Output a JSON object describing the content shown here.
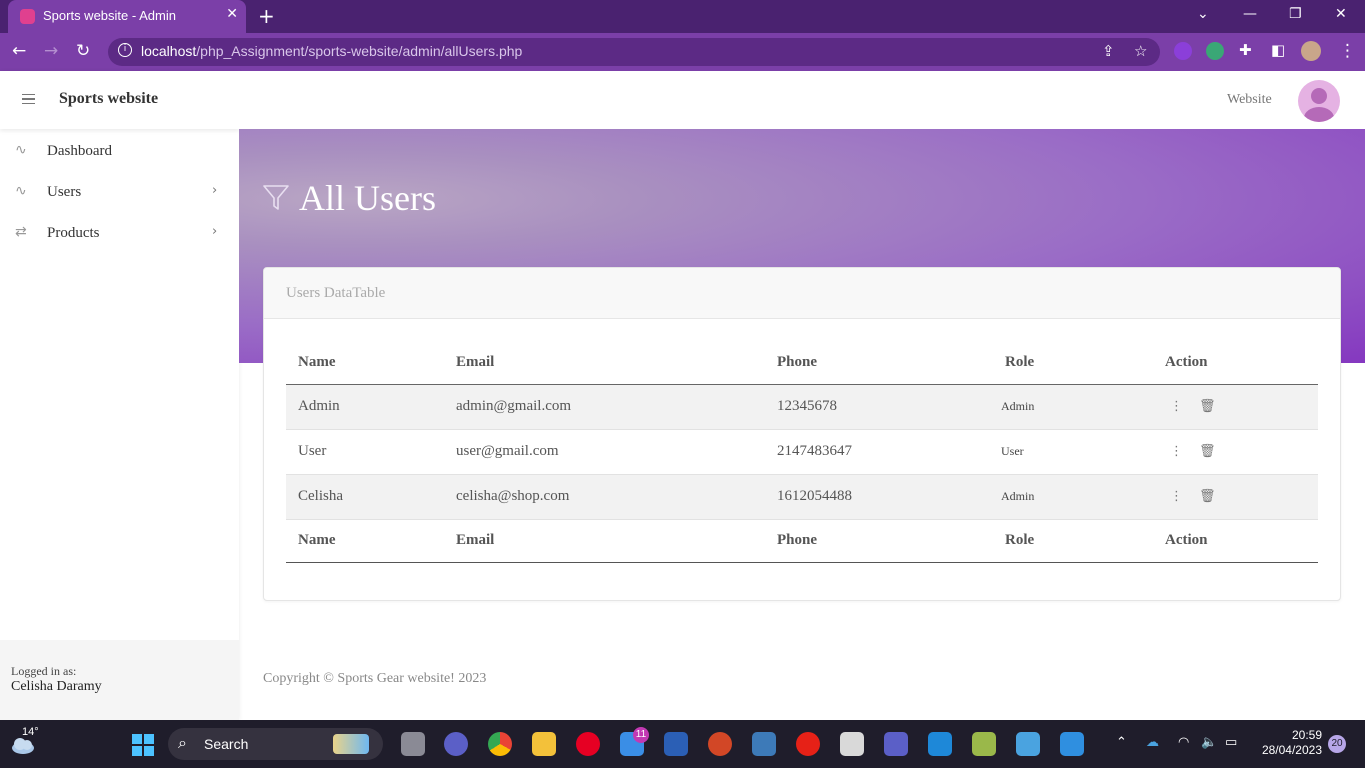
{
  "browser": {
    "tab_title": "Sports website - Admin",
    "url_host": "localhost",
    "url_path": "/php_Assignment/sports-website/admin/allUsers.php"
  },
  "sidebar": {
    "brand": "Sports website",
    "items": [
      {
        "label": "Dashboard",
        "icon": "activity-icon"
      },
      {
        "label": "Users",
        "icon": "activity-icon"
      },
      {
        "label": "Products",
        "icon": "repeat-icon"
      }
    ],
    "footer": {
      "logged_in_label": "Logged in as:",
      "user_name": "Celisha Daramy"
    }
  },
  "topbar": {
    "website_link": "Website"
  },
  "hero": {
    "title": "All Users"
  },
  "card": {
    "header": "Users DataTable"
  },
  "table": {
    "columns": [
      "Name",
      "Email",
      "Phone",
      "Role",
      "Action"
    ],
    "rows": [
      {
        "name": "Admin",
        "email": "admin@gmail.com",
        "phone": "12345678",
        "role": "Admin"
      },
      {
        "name": "User",
        "email": "user@gmail.com",
        "phone": "2147483647",
        "role": "User"
      },
      {
        "name": "Celisha",
        "email": "celisha@shop.com",
        "phone": "1612054488",
        "role": "Admin"
      }
    ]
  },
  "footer": {
    "copyright": "Copyright © Sports Gear website! 2023"
  },
  "taskbar": {
    "temperature": "14°",
    "search_label": "Search",
    "mail_badge": "11",
    "time": "20:59",
    "date": "28/04/2023",
    "notifications": "20"
  },
  "colors": {
    "accent": "#7b3fa8",
    "hero_end": "#8538c0",
    "tabbar": "#4a2270"
  }
}
